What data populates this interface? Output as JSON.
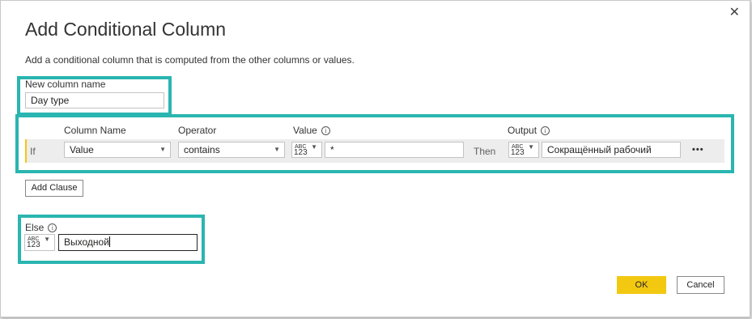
{
  "dialog": {
    "title": "Add Conditional Column",
    "description": "Add a conditional column that is computed from the other columns or values."
  },
  "new_column": {
    "label": "New column name",
    "value": "Day type"
  },
  "clause_headers": {
    "column_name": "Column Name",
    "operator": "Operator",
    "value": "Value",
    "output": "Output"
  },
  "clause": {
    "if_label": "If",
    "column": "Value",
    "operator": "contains",
    "value_type_abc": "ABC",
    "value_type_123": "123",
    "value": "*",
    "then_label": "Then",
    "output_type_abc": "ABC",
    "output_type_123": "123",
    "output": "Сокращённый рабочий",
    "more": "•••"
  },
  "add_clause_label": "Add Clause",
  "else": {
    "label": "Else",
    "type_abc": "ABC",
    "type_123": "123",
    "value": "Выходной"
  },
  "buttons": {
    "ok": "OK",
    "cancel": "Cancel"
  },
  "icons": {
    "close": "✕",
    "info": "i",
    "dropdown": "▼"
  },
  "colors": {
    "highlight": "#2ab5b0",
    "ok_button": "#f2c811",
    "clause_accent": "#f2c811"
  }
}
